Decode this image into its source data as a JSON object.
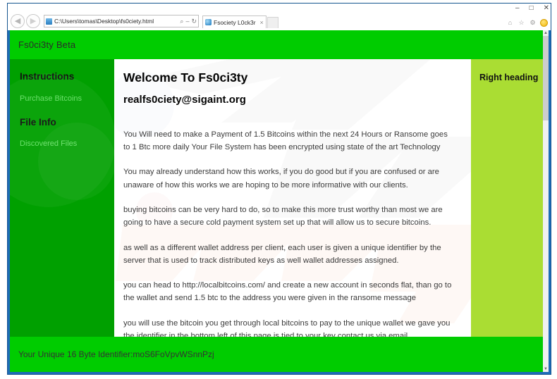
{
  "browser": {
    "back_icon": "back-arrow-icon",
    "forward_icon": "forward-arrow-icon",
    "url": "C:\\Users\\tomas\\Desktop\\fs0ciety.html",
    "search_icon": "search-icon",
    "refresh_icon": "refresh-icon",
    "tab_title": "Fsociety L0ck3r",
    "tab_close_label": "×",
    "window_controls": {
      "minimize": "–",
      "maximize": "□",
      "close": "✕"
    },
    "toolbar_icons": [
      "home-icon",
      "favorites-star-icon",
      "tools-gear-icon",
      "smiley-icon"
    ],
    "scroll_up_label": "▲",
    "scroll_down_label": "▼"
  },
  "page": {
    "header": {
      "brand": "Fs0ci3ty Beta"
    },
    "sidebar": {
      "items": [
        {
          "label": "Instructions",
          "type": "heading"
        },
        {
          "label": "Purchase Bitcoins",
          "type": "link"
        },
        {
          "label": "File Info",
          "type": "heading"
        },
        {
          "label": "Discovered Files",
          "type": "link"
        }
      ]
    },
    "main": {
      "title": "Welcome To Fs0ci3ty",
      "email": "realfs0ciety@sigaint.org",
      "paragraphs": [
        "You Will need to make a Payment of 1.5 Bitcoins within the next 24 Hours or Ransome goes to 1 Btc more daily Your File System has been encrypted using state of the art Technology",
        "You may already understand how this works, if you do good but if you are confused or are unaware of how this works we are hoping to be more informative with our clients.",
        "buying bitcoins can be very hard to do, so to make this more trust worthy than most we are going to have a secure cold payment system set up that will allow us to secure bitcoins.",
        "as well as a different wallet address per client, each user is given a unique identifier by the server that is used to track distributed keys as well wallet addresses assigned.",
        "you can head to http://localbitcoins.com/ and create a new account in seconds flat, than go to the wallet and send 1.5 btc to the address you were given in the ransome message",
        "you will use the bitcoin you get through local bitcoins to pay to the unique wallet we gave you the identifier in the bottom left of this page is tied to your key contact us via email"
      ]
    },
    "rightbar": {
      "heading": "Right heading"
    },
    "footer": {
      "unique_id_text": "Your Unique 16 Byte Identifier:moS6FoVpvWSnnPzj"
    },
    "colors": {
      "header_green": "#00cc00",
      "sidebar_green": "#00a000",
      "rightbar_green": "#aadd33",
      "link_green": "#66e066",
      "window_blue": "#1e6bb8"
    }
  }
}
